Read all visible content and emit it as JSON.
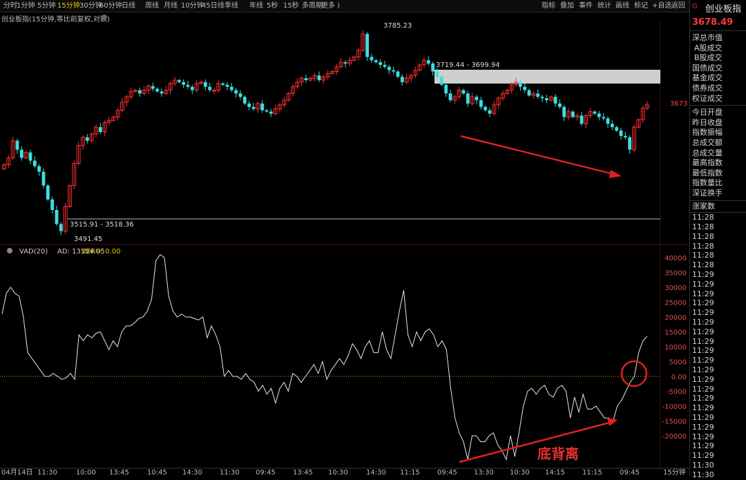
{
  "toolbar": {
    "periods": [
      "分时",
      "1分钟",
      "5分钟",
      "15分钟",
      "30分钟",
      "60分钟",
      "日线",
      "周线",
      "月线",
      "10分钟",
      "45日线",
      "季线",
      "年线",
      "5秒",
      "15秒",
      "多周期",
      "更多 )"
    ],
    "active_period": "15分钟",
    "tools": [
      "指标",
      "叠加",
      "事件",
      "统计",
      "画线",
      "标记",
      "+自选",
      "返回"
    ]
  },
  "subtitle": "创业板指(15分钟,等比前复权,对数)",
  "sidebar": {
    "marker": "G",
    "title": "创业板指",
    "price": "3678.49",
    "market_items": [
      "深总市值",
      "A股成交",
      "B股成交",
      "国债成交",
      "基金成交",
      "债券成交",
      "权证成交"
    ],
    "index_items": [
      "今日开盘",
      "昨日收盘",
      "指数振幅",
      "总成交额",
      "总成交量",
      "最高指数",
      "最低指数",
      "指数量比",
      "深证换手"
    ],
    "rise_label": "涨家数",
    "times": [
      "11:28",
      "11:28",
      "11:28",
      "11:28",
      "11:28",
      "11:28",
      "11:29",
      "11:29",
      "11:29",
      "11:29",
      "11:29",
      "11:29",
      "11:29",
      "11:29",
      "11:29",
      "11:29",
      "11:29",
      "11:29",
      "11:29",
      "11:29",
      "11:29",
      "11:29",
      "11:29",
      "11:29",
      "11:29",
      "11:29",
      "11:30",
      "11:30"
    ]
  },
  "chart_data": [
    {
      "type": "candlestick",
      "title": "创业板指",
      "y_scale": "log",
      "price_label": "3673",
      "annotations": {
        "high": "3785.23",
        "low": "3491.45",
        "upper_zone": "3719.44 - 3699.94",
        "lower_line": "3515.91 - 3518.36"
      },
      "closes": [
        3590,
        3600,
        3625,
        3612,
        3600,
        3608,
        3596,
        3588,
        3580,
        3560,
        3540,
        3525,
        3505,
        3495,
        3530,
        3560,
        3592,
        3618,
        3630,
        3625,
        3635,
        3645,
        3638,
        3652,
        3655,
        3660,
        3670,
        3682,
        3690,
        3698,
        3700,
        3695,
        3700,
        3706,
        3702,
        3698,
        3695,
        3700,
        3710,
        3715,
        3712,
        3708,
        3705,
        3700,
        3710,
        3712,
        3705,
        3700,
        3700,
        3710,
        3708,
        3705,
        3700,
        3695,
        3690,
        3680,
        3675,
        3672,
        3680,
        3670,
        3668,
        3665,
        3672,
        3678,
        3685,
        3695,
        3705,
        3712,
        3718,
        3715,
        3718,
        3722,
        3715,
        3720,
        3725,
        3728,
        3735,
        3742,
        3740,
        3745,
        3750,
        3760,
        3785,
        3750,
        3745,
        3742,
        3738,
        3735,
        3730,
        3728,
        3720,
        3712,
        3718,
        3722,
        3730,
        3738,
        3745,
        3740,
        3728,
        3720,
        3708,
        3695,
        3685,
        3690,
        3700,
        3695,
        3680,
        3690,
        3685,
        3675,
        3670,
        3665,
        3678,
        3688,
        3695,
        3700,
        3708,
        3712,
        3705,
        3700,
        3692,
        3695,
        3690,
        3688,
        3685,
        3690,
        3680,
        3675,
        3660,
        3668,
        3660,
        3662,
        3650,
        3662,
        3668,
        3665,
        3660,
        3658,
        3650,
        3645,
        3640,
        3632,
        3630,
        3612,
        3645,
        3656,
        3673,
        3678
      ],
      "vad": {
        "title": "VAD(20)",
        "ad": "13504.95",
        "zero": "0.00",
        "y_ticks": [
          40000,
          35000,
          30000,
          25000,
          20000,
          15000,
          10000,
          5000,
          0,
          -5000,
          -10000,
          -15000,
          -20000
        ],
        "y_tick_labels": [
          "40000",
          "35000",
          "30000",
          "25000",
          "20000",
          "15000",
          "10000",
          "5000",
          "0.00",
          "-5000",
          "-10000",
          "-15000",
          "-20000"
        ],
        "x_labels": [
          "04月14日",
          "11:30",
          "10:00",
          "13:45",
          "10:45",
          "14:30",
          "11:30",
          "09:45",
          "13:45",
          "10:30",
          "14:30",
          "11:15",
          "09:45",
          "13:30",
          "10:30",
          "14:15",
          "11:15",
          "09:45",
          "15分钟"
        ],
        "values": [
          21000,
          28000,
          30000,
          28000,
          27000,
          20000,
          8000,
          6000,
          4000,
          2000,
          0,
          0,
          1000,
          0,
          -1000,
          -500,
          1000,
          -1000,
          14000,
          12000,
          14000,
          13000,
          14500,
          15000,
          12000,
          9000,
          12000,
          10000,
          15000,
          17000,
          17000,
          18000,
          19500,
          20000,
          22000,
          26000,
          39000,
          41000,
          40000,
          27000,
          22000,
          20000,
          21000,
          20000,
          20000,
          19500,
          19000,
          20000,
          13000,
          17000,
          14000,
          10000,
          0,
          2000,
          0,
          0,
          -1000,
          1000,
          -1000,
          -2000,
          -5000,
          -3000,
          -6000,
          -4000,
          -9000,
          -4000,
          -2000,
          -5000,
          1000,
          0,
          -2000,
          0,
          2000,
          4000,
          1000,
          5000,
          -1000,
          2000,
          4000,
          6000,
          4000,
          7000,
          11000,
          9000,
          6000,
          10000,
          12000,
          8000,
          8000,
          15000,
          9000,
          6000,
          14000,
          22000,
          29000,
          14000,
          10000,
          15000,
          12000,
          15000,
          16000,
          14000,
          10000,
          12000,
          9000,
          -4000,
          -14000,
          -19000,
          -22000,
          -28000,
          -20000,
          -20000,
          -22000,
          -22000,
          -20000,
          -19000,
          -23000,
          -25000,
          -28000,
          -20000,
          -27000,
          -19000,
          -10000,
          -5000,
          -4000,
          -6000,
          -4000,
          -3000,
          -6000,
          -7000,
          -4000,
          -3000,
          -5000,
          -14000,
          -7000,
          -12000,
          -6000,
          -11000,
          -11000,
          -10000,
          -12000,
          -14000,
          -14000,
          -15000,
          -10000,
          -8000,
          -5000,
          -2000,
          0,
          8000,
          12000,
          13500
        ]
      }
    }
  ],
  "callouts": {
    "divergence": "底背离"
  }
}
